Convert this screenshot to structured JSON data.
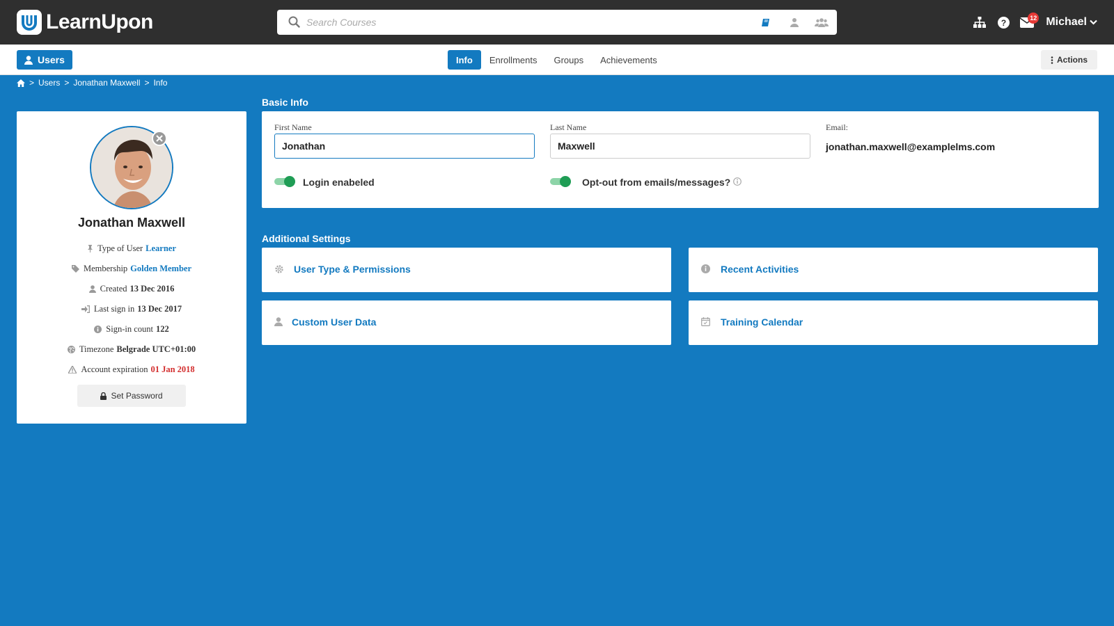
{
  "brand": {
    "name": "LearnUpon"
  },
  "search": {
    "placeholder": "Search Courses"
  },
  "header": {
    "notifications_count": "12",
    "user_name": "Michael"
  },
  "subnav": {
    "users_label": "Users",
    "tabs": [
      {
        "label": "Info",
        "active": true
      },
      {
        "label": "Enrollments",
        "active": false
      },
      {
        "label": "Groups",
        "active": false
      },
      {
        "label": "Achievements",
        "active": false
      }
    ],
    "actions_label": "Actions"
  },
  "breadcrumb": {
    "items": [
      "Users",
      "Jonathan Maxwell",
      "Info"
    ],
    "separator": ">"
  },
  "profile": {
    "name": "Jonathan Maxwell",
    "meta": [
      {
        "label": "Type of User",
        "value": "Learner",
        "style": "link"
      },
      {
        "label": "Membership",
        "value": "Golden Member",
        "style": "link"
      },
      {
        "label": "Created",
        "value": "13 Dec 2016",
        "style": "bold"
      },
      {
        "label": "Last sign in",
        "value": "13 Dec 2017",
        "style": "bold"
      },
      {
        "label": "Sign-in count",
        "value": "122",
        "style": "bold"
      },
      {
        "label": "Timezone",
        "value": "Belgrade UTC+01:00",
        "style": "bold"
      },
      {
        "label": "Account expiration",
        "value": "01 Jan 2018",
        "style": "danger"
      }
    ],
    "set_password_label": "Set Password"
  },
  "basic_info": {
    "title": "Basic Info",
    "first_name_label": "First Name",
    "first_name_value": "Jonathan",
    "last_name_label": "Last Name",
    "last_name_value": "Maxwell",
    "email_label": "Email:",
    "email_value": "jonathan.maxwell@examplelms.com",
    "login_enabled_label": "Login enabeled",
    "login_enabled": true,
    "opt_out_label": "Opt-out from emails/messages?",
    "opt_out": true
  },
  "additional_settings": {
    "title": "Additional Settings",
    "items": [
      {
        "label": "User Type & Permissions",
        "icon": "gear-icon"
      },
      {
        "label": "Recent Activities",
        "icon": "info-icon"
      },
      {
        "label": "Custom User Data",
        "icon": "user-icon"
      },
      {
        "label": "Training Calendar",
        "icon": "calendar-icon"
      }
    ]
  },
  "colors": {
    "accent": "#137ac0",
    "topbar": "#2f2f2f",
    "toggle_on": "#1f9d55",
    "danger": "#d32f2f"
  }
}
